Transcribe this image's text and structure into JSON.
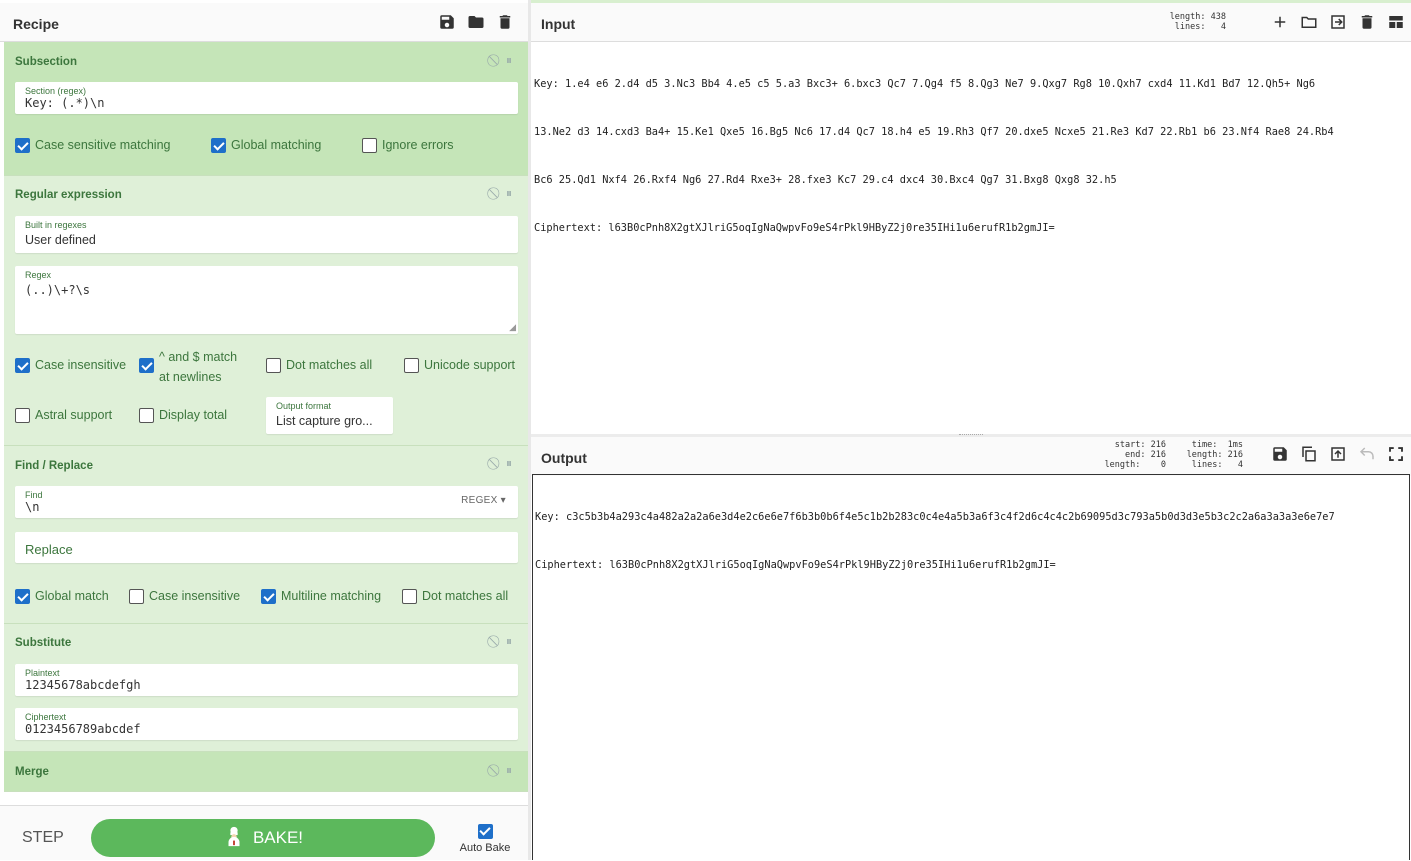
{
  "recipe": {
    "title": "Recipe",
    "operations": {
      "subsection": {
        "title": "Subsection",
        "section_label": "Section (regex)",
        "section_value": "Key: (.*)\\n",
        "options": [
          {
            "label": "Case sensitive matching",
            "checked": true
          },
          {
            "label": "Global matching",
            "checked": true
          },
          {
            "label": "Ignore errors",
            "checked": false
          }
        ]
      },
      "regex": {
        "title": "Regular expression",
        "builtin_label": "Built in regexes",
        "builtin_value": "User defined",
        "regex_label": "Regex",
        "regex_value": "(..)\\+?\\s",
        "options": [
          {
            "label": "Case insensitive",
            "checked": true
          },
          {
            "label": "^ and $ match at newlines",
            "checked": true
          },
          {
            "label": "Dot matches all",
            "checked": false
          },
          {
            "label": "Unicode support",
            "checked": false
          },
          {
            "label": "Astral support",
            "checked": false
          },
          {
            "label": "Display total",
            "checked": false
          }
        ],
        "output_format_label": "Output format",
        "output_format_value": "List capture gro..."
      },
      "find_replace": {
        "title": "Find / Replace",
        "find_label": "Find",
        "find_value": "\\n",
        "find_mode": "REGEX",
        "replace_placeholder": "Replace",
        "options": [
          {
            "label": "Global match",
            "checked": true
          },
          {
            "label": "Case insensitive",
            "checked": false
          },
          {
            "label": "Multiline matching",
            "checked": true
          },
          {
            "label": "Dot matches all",
            "checked": false
          }
        ]
      },
      "substitute": {
        "title": "Substitute",
        "plaintext_label": "Plaintext",
        "plaintext_value": "12345678abcdefgh",
        "ciphertext_label": "Ciphertext",
        "ciphertext_value": "0123456789abcdef"
      },
      "merge": {
        "title": "Merge"
      }
    },
    "controls": {
      "step_label": "STEP",
      "bake_label": "BAKE!",
      "auto_bake_label": "Auto Bake",
      "auto_bake_checked": true
    }
  },
  "input": {
    "title": "Input",
    "length_label": "length:",
    "length_value": "438",
    "lines_label": "lines:",
    "lines_value": "4",
    "lines": [
      "Key: 1.e4 e6 2.d4 d5 3.Nc3 Bb4 4.e5 c5 5.a3 Bxc3+ 6.bxc3 Qc7 7.Qg4 f5 8.Qg3 Ne7 9.Qxg7 Rg8 10.Qxh7 cxd4 11.Kd1 Bd7 12.Qh5+ Ng6",
      "13.Ne2 d3 14.cxd3 Ba4+ 15.Ke1 Qxe5 16.Bg5 Nc6 17.d4 Qc7 18.h4 e5 19.Rh3 Qf7 20.dxe5 Ncxe5 21.Re3 Kd7 22.Rb1 b6 23.Nf4 Rae8 24.Rb4",
      "Bc6 25.Qd1 Nxf4 26.Rxf4 Ng6 27.Rd4 Rxe3+ 28.fxe3 Kc7 29.c4 dxc4 30.Bxc4 Qg7 31.Bxg8 Qxg8 32.h5",
      "Ciphertext: l63B0cPnh8X2gtXJlriG5oqIgNaQwpvFo9eS4rPkl9HByZ2j0re35IHi1u6erufR1b2gmJI="
    ]
  },
  "output": {
    "title": "Output",
    "start_label": "start:",
    "start_value": "216",
    "end_label": "end:",
    "end_value": "216",
    "length_label": "length:",
    "length_value": "0",
    "time_label": "time:",
    "time_value": "1ms",
    "olength_label": "length:",
    "olength_value": "216",
    "lines_label": "lines:",
    "lines_value": "4",
    "lines": [
      "Key: c3c5b3b4a293c4a482a2a2a6e3d4e2c6e6e7f6b3b0b6f4e5c1b2b283c0c4e4a5b3a6f3c4f2d6c4c4c2b69095d3c793a5b0d3d3e5b3c2c2a6a3a3a3e6e7e7",
      "Ciphertext: l63B0cPnh8X2gtXJlriG5oqIgNaQwpvFo9eS4rPkl9HByZ2j0re35IHi1u6erufR1b2gmJI="
    ]
  }
}
